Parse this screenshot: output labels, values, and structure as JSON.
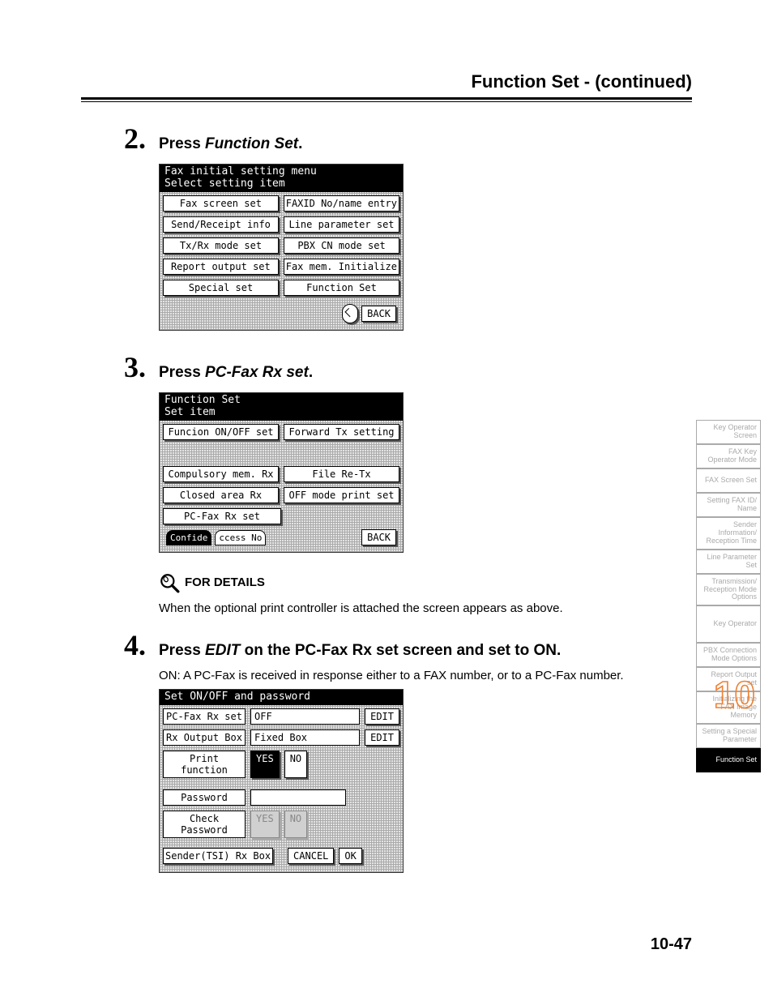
{
  "header": {
    "title": "Function Set -  (continued)"
  },
  "steps": {
    "s2": {
      "num": "2.",
      "text_pre": "Press ",
      "text_em": "Function Set",
      "text_post": "."
    },
    "s3": {
      "num": "3.",
      "text_pre": "Press ",
      "text_em": "PC-Fax Rx set",
      "text_post": "."
    },
    "s4": {
      "num": "4.",
      "text_pre": "Press ",
      "text_em": "EDIT",
      "text_post": " on the PC-Fax Rx set screen and set to ON.",
      "sub": "ON: A PC-Fax is received in response either to a FAX number, or to a PC-Fax number."
    }
  },
  "for_details": {
    "label": "FOR DETAILS",
    "body": "When the optional print controller is attached the screen appears as above."
  },
  "lcd1": {
    "titleLine1": "Fax initial setting menu",
    "titleLine2": "Select setting item",
    "rows": [
      [
        "Fax screen set",
        "FAXID No/name entry"
      ],
      [
        "Send/Receipt info",
        "Line parameter set"
      ],
      [
        "Tx/Rx mode set",
        "PBX CN mode set"
      ],
      [
        "Report output set",
        "Fax mem. Initialize"
      ],
      [
        "Special set",
        "Function Set"
      ]
    ],
    "back": "BACK"
  },
  "lcd2": {
    "titleLine1": "Function Set",
    "titleLine2": "Set item",
    "rows": [
      [
        "Funcion ON/OFF set",
        "Forward Tx setting"
      ],
      [
        "",
        ""
      ],
      [
        "Compulsory mem. Rx",
        "File Re-Tx"
      ],
      [
        "Closed area Rx",
        "OFF mode print set"
      ],
      [
        "PC-Fax Rx set",
        ""
      ]
    ],
    "tabs": [
      "Confide",
      "ccess No"
    ],
    "back": "BACK"
  },
  "lcd3": {
    "title": "Set ON/OFF and password",
    "r1_label": "PC-Fax Rx set",
    "r1_val": "OFF",
    "r1_edit": "EDIT",
    "r2_label": "Rx Output Box",
    "r2_val": "Fixed Box",
    "r2_edit": "EDIT",
    "r3_label": "Print function",
    "r3_yes": "YES",
    "r3_no": "NO",
    "r4_label": "Password",
    "r4_val": "",
    "r5_label": "Check Password",
    "r5_yes": "YES",
    "r5_no": "NO",
    "r6_label": "Sender(TSI) Rx Box",
    "r6_cancel": "CANCEL",
    "r6_ok": "OK"
  },
  "side_tabs": [
    "Key Operator Screen",
    "FAX Key Operator Mode",
    "FAX Screen Set",
    "Setting FAX ID/ Name",
    "Sender Information/ Reception Time",
    "Line Parameter Set",
    "Transmission/ Reception Mode Options",
    "Key Operator",
    "PBX Connection Mode Options",
    "Report Output set",
    "Initializing the FAX Image Memory",
    "Setting a Special Parameter",
    "Function Set"
  ],
  "side_active_index": 12,
  "page_number": "10-47",
  "chapter_number_overlay": "10"
}
